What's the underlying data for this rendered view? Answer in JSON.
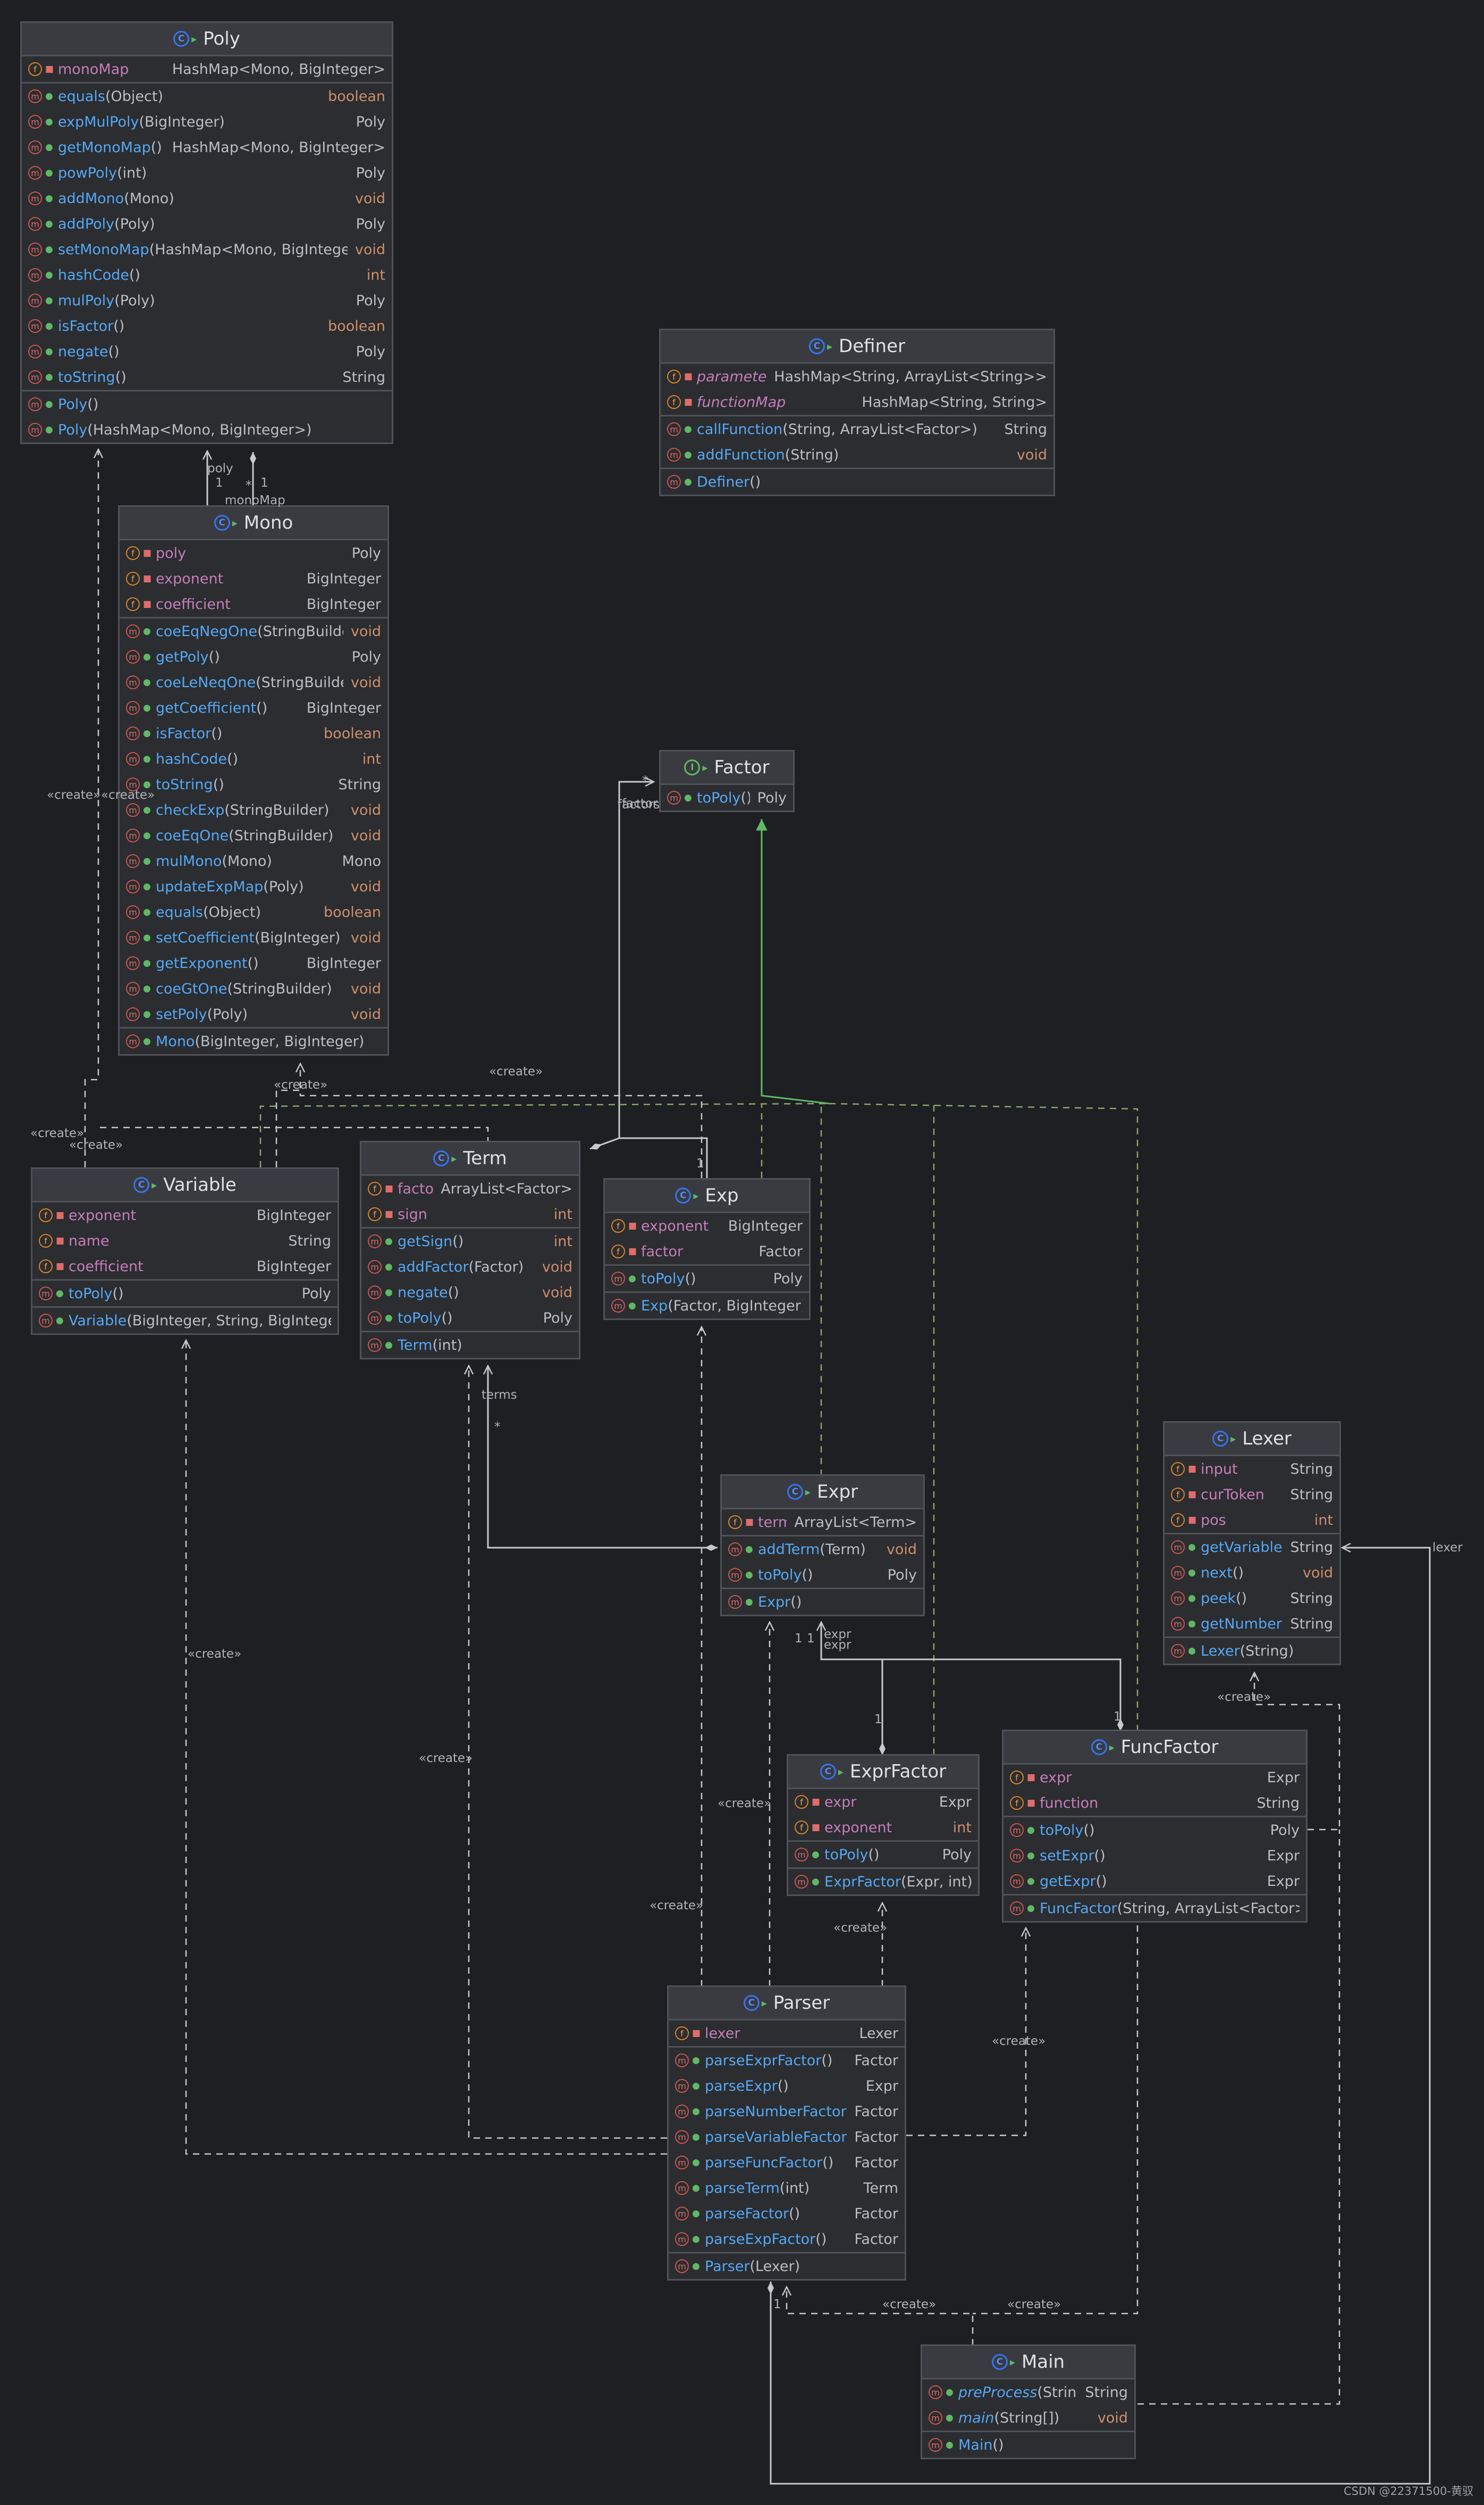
{
  "classes": [
    {
      "id": "poly",
      "name": "Poly",
      "kind": "class",
      "fields": [
        {
          "name": "monoMap",
          "type": "HashMap<Mono, BigInteger>"
        }
      ],
      "methods": [
        {
          "name": "equals",
          "params": "(Object)",
          "type": "boolean"
        },
        {
          "name": "expMulPoly",
          "params": "(BigInteger)",
          "type": "Poly"
        },
        {
          "name": "getMonoMap",
          "params": "()",
          "type": "HashMap<Mono, BigInteger>"
        },
        {
          "name": "powPoly",
          "params": "(int)",
          "type": "Poly"
        },
        {
          "name": "addMono",
          "params": "(Mono)",
          "type": "void"
        },
        {
          "name": "addPoly",
          "params": "(Poly)",
          "type": "Poly"
        },
        {
          "name": "setMonoMap",
          "params": "(HashMap<Mono, BigInteger>)",
          "type": "void"
        },
        {
          "name": "hashCode",
          "params": "()",
          "type": "int"
        },
        {
          "name": "mulPoly",
          "params": "(Poly)",
          "type": "Poly"
        },
        {
          "name": "isFactor",
          "params": "()",
          "type": "boolean"
        },
        {
          "name": "negate",
          "params": "()",
          "type": "Poly"
        },
        {
          "name": "toString",
          "params": "()",
          "type": "String"
        }
      ],
      "constructors": [
        {
          "name": "Poly",
          "params": "()"
        },
        {
          "name": "Poly",
          "params": "(HashMap<Mono, BigInteger>)"
        }
      ]
    },
    {
      "id": "definer",
      "name": "Definer",
      "kind": "class",
      "fields": [
        {
          "name": "parameterMap",
          "type": "HashMap<String, ArrayList<String>>",
          "static": true
        },
        {
          "name": "functionMap",
          "type": "HashMap<String, String>",
          "static": true
        }
      ],
      "methods": [
        {
          "name": "callFunction",
          "params": "(String, ArrayList<Factor>)",
          "type": "String"
        },
        {
          "name": "addFunction",
          "params": "(String)",
          "type": "void"
        }
      ],
      "constructors": [
        {
          "name": "Definer",
          "params": "()"
        }
      ]
    },
    {
      "id": "mono",
      "name": "Mono",
      "kind": "class",
      "fields": [
        {
          "name": "poly",
          "type": "Poly"
        },
        {
          "name": "exponent",
          "type": "BigInteger"
        },
        {
          "name": "coefficient",
          "type": "BigInteger"
        }
      ],
      "methods": [
        {
          "name": "coeEqNegOne",
          "params": "(StringBuilder)",
          "type": "void"
        },
        {
          "name": "getPoly",
          "params": "()",
          "type": "Poly"
        },
        {
          "name": "coeLeNeqOne",
          "params": "(StringBuilder)",
          "type": "void"
        },
        {
          "name": "getCoefficient",
          "params": "()",
          "type": "BigInteger"
        },
        {
          "name": "isFactor",
          "params": "()",
          "type": "boolean"
        },
        {
          "name": "hashCode",
          "params": "()",
          "type": "int"
        },
        {
          "name": "toString",
          "params": "()",
          "type": "String"
        },
        {
          "name": "checkExp",
          "params": "(StringBuilder)",
          "type": "void"
        },
        {
          "name": "coeEqOne",
          "params": "(StringBuilder)",
          "type": "void"
        },
        {
          "name": "mulMono",
          "params": "(Mono)",
          "type": "Mono"
        },
        {
          "name": "updateExpMap",
          "params": "(Poly)",
          "type": "void"
        },
        {
          "name": "equals",
          "params": "(Object)",
          "type": "boolean"
        },
        {
          "name": "setCoefficient",
          "params": "(BigInteger)",
          "type": "void"
        },
        {
          "name": "getExponent",
          "params": "()",
          "type": "BigInteger"
        },
        {
          "name": "coeGtOne",
          "params": "(StringBuilder)",
          "type": "void"
        },
        {
          "name": "setPoly",
          "params": "(Poly)",
          "type": "void"
        }
      ],
      "constructors": [
        {
          "name": "Mono",
          "params": "(BigInteger, BigInteger)"
        }
      ]
    },
    {
      "id": "factor",
      "name": "Factor",
      "kind": "interface",
      "fields": [],
      "methods": [
        {
          "name": "toPoly",
          "params": "()",
          "type": "Poly"
        }
      ],
      "constructors": []
    },
    {
      "id": "variable",
      "name": "Variable",
      "kind": "class",
      "fields": [
        {
          "name": "exponent",
          "type": "BigInteger"
        },
        {
          "name": "name",
          "type": "String"
        },
        {
          "name": "coefficient",
          "type": "BigInteger"
        }
      ],
      "methods": [
        {
          "name": "toPoly",
          "params": "()",
          "type": "Poly"
        }
      ],
      "constructors": [
        {
          "name": "Variable",
          "params": "(BigInteger, String, BigInteger)"
        }
      ]
    },
    {
      "id": "term",
      "name": "Term",
      "kind": "class",
      "fields": [
        {
          "name": "factors",
          "type": "ArrayList<Factor>"
        },
        {
          "name": "sign",
          "type": "int"
        }
      ],
      "methods": [
        {
          "name": "getSign",
          "params": "()",
          "type": "int"
        },
        {
          "name": "addFactor",
          "params": "(Factor)",
          "type": "void"
        },
        {
          "name": "negate",
          "params": "()",
          "type": "void"
        },
        {
          "name": "toPoly",
          "params": "()",
          "type": "Poly"
        }
      ],
      "constructors": [
        {
          "name": "Term",
          "params": "(int)"
        }
      ]
    },
    {
      "id": "exp",
      "name": "Exp",
      "kind": "class",
      "fields": [
        {
          "name": "exponent",
          "type": "BigInteger"
        },
        {
          "name": "factor",
          "type": "Factor"
        }
      ],
      "methods": [
        {
          "name": "toPoly",
          "params": "()",
          "type": "Poly"
        }
      ],
      "constructors": [
        {
          "name": "Exp",
          "params": "(Factor, BigInteger)"
        }
      ]
    },
    {
      "id": "lexer",
      "name": "Lexer",
      "kind": "class",
      "fields": [
        {
          "name": "input",
          "type": "String"
        },
        {
          "name": "curToken",
          "type": "String"
        },
        {
          "name": "pos",
          "type": "int"
        }
      ],
      "methods": [
        {
          "name": "getVariable",
          "params": "()",
          "type": "String"
        },
        {
          "name": "next",
          "params": "()",
          "type": "void"
        },
        {
          "name": "peek",
          "params": "()",
          "type": "String"
        },
        {
          "name": "getNumber",
          "params": "()",
          "type": "String"
        }
      ],
      "constructors": [
        {
          "name": "Lexer",
          "params": "(String)"
        }
      ]
    },
    {
      "id": "expr",
      "name": "Expr",
      "kind": "class",
      "fields": [
        {
          "name": "terms",
          "type": "ArrayList<Term>"
        }
      ],
      "methods": [
        {
          "name": "addTerm",
          "params": "(Term)",
          "type": "void"
        },
        {
          "name": "toPoly",
          "params": "()",
          "type": "Poly"
        }
      ],
      "constructors": [
        {
          "name": "Expr",
          "params": "()"
        }
      ]
    },
    {
      "id": "exprfactor",
      "name": "ExprFactor",
      "kind": "class",
      "fields": [
        {
          "name": "expr",
          "type": "Expr"
        },
        {
          "name": "exponent",
          "type": "int"
        }
      ],
      "methods": [
        {
          "name": "toPoly",
          "params": "()",
          "type": "Poly"
        }
      ],
      "constructors": [
        {
          "name": "ExprFactor",
          "params": "(Expr, int)"
        }
      ]
    },
    {
      "id": "funcfactor",
      "name": "FuncFactor",
      "kind": "class",
      "fields": [
        {
          "name": "expr",
          "type": "Expr"
        },
        {
          "name": "function",
          "type": "String"
        }
      ],
      "methods": [
        {
          "name": "toPoly",
          "params": "()",
          "type": "Poly"
        },
        {
          "name": "setExpr",
          "params": "()",
          "type": "Expr"
        },
        {
          "name": "getExpr",
          "params": "()",
          "type": "Expr"
        }
      ],
      "constructors": [
        {
          "name": "FuncFactor",
          "params": "(String, ArrayList<Factor>)"
        }
      ]
    },
    {
      "id": "parser",
      "name": "Parser",
      "kind": "class",
      "fields": [
        {
          "name": "lexer",
          "type": "Lexer"
        }
      ],
      "methods": [
        {
          "name": "parseExprFactor",
          "params": "()",
          "type": "Factor"
        },
        {
          "name": "parseExpr",
          "params": "()",
          "type": "Expr"
        },
        {
          "name": "parseNumberFactor",
          "params": "()",
          "type": "Factor"
        },
        {
          "name": "parseVariableFactor",
          "params": "()",
          "type": "Factor"
        },
        {
          "name": "parseFuncFactor",
          "params": "()",
          "type": "Factor"
        },
        {
          "name": "parseTerm",
          "params": "(int)",
          "type": "Term"
        },
        {
          "name": "parseFactor",
          "params": "()",
          "type": "Factor"
        },
        {
          "name": "parseExpFactor",
          "params": "()",
          "type": "Factor"
        }
      ],
      "constructors": [
        {
          "name": "Parser",
          "params": "(Lexer)"
        }
      ]
    },
    {
      "id": "main",
      "name": "Main",
      "kind": "class",
      "fields": [],
      "methods": [
        {
          "name": "preProcess",
          "params": "(String)",
          "type": "String",
          "static": true
        },
        {
          "name": "main",
          "params": "(String[])",
          "type": "void",
          "static": true
        }
      ],
      "constructors": [
        {
          "name": "Main",
          "params": "()"
        }
      ]
    }
  ],
  "labels": {
    "poly_role": "poly",
    "one": "1",
    "star": "*",
    "monoMap_role": "monoMap",
    "factor_role": "factor",
    "factors_role": "factors",
    "terms_role": "terms",
    "expr_role": "expr",
    "lexer_role": "lexer",
    "create": "«create»"
  },
  "watermark": "CSDN @22371500-黄驭",
  "colors": {
    "background": "#1e1f22",
    "box": "#2b2d30",
    "border": "#4e5157",
    "method": "#56a8f5",
    "field": "#c77dbb",
    "keyword": "#cf8e6d",
    "edge": "#c7c9ce",
    "realization": "#5fb865",
    "dependency": "#9ab86a"
  }
}
